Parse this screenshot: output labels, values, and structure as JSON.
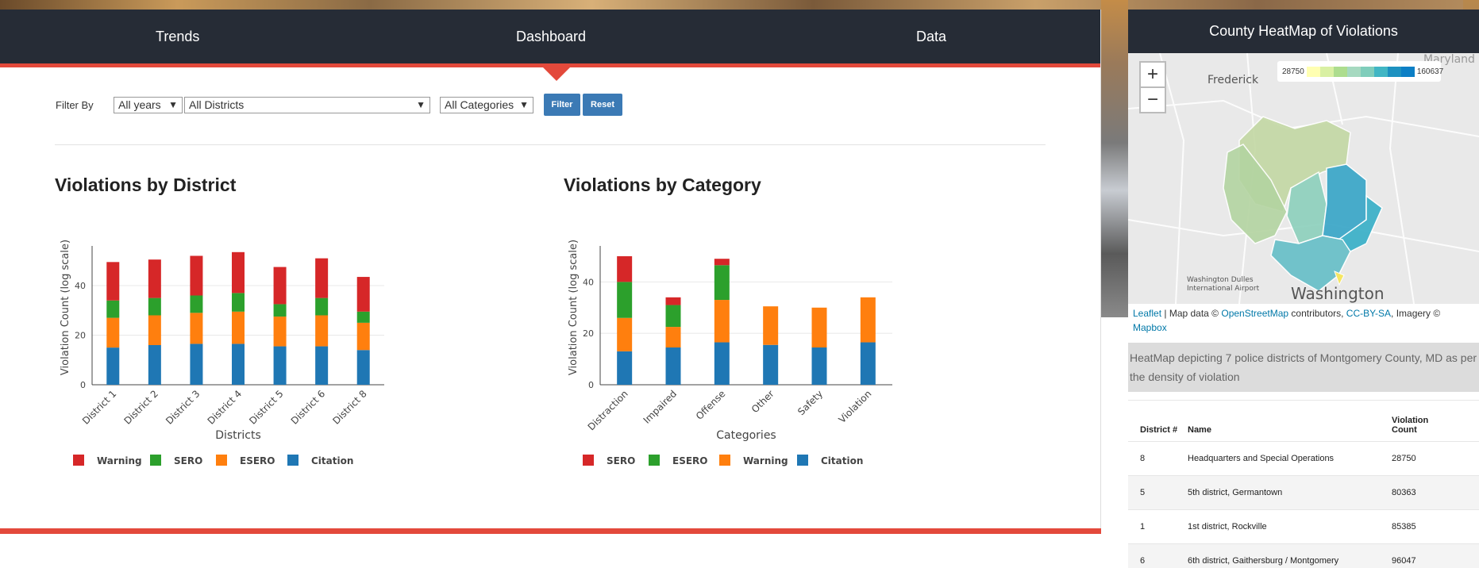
{
  "nav": {
    "items": [
      "Trends",
      "Dashboard",
      "Data"
    ]
  },
  "filters": {
    "label": "Filter By",
    "year": "All years",
    "district": "All Districts",
    "category": "All Categories",
    "filter_button": "Filter",
    "reset_button": "Reset"
  },
  "chart1": {
    "title": "Violations by District",
    "chart_data": {
      "type": "bar",
      "stacked": true,
      "xlabel": "Districts",
      "ylabel": "Violation Count (log scale)",
      "yticks": [
        0,
        20,
        40
      ],
      "ylim": [
        0,
        56
      ],
      "categories": [
        "District 1",
        "District 2",
        "District 3",
        "District 4",
        "District 5",
        "District 6",
        "District 8"
      ],
      "series": [
        {
          "name": "Citation",
          "color": "#1f77b4",
          "values": [
            15,
            16,
            16.5,
            16.5,
            15.5,
            15.5,
            14
          ]
        },
        {
          "name": "ESERO",
          "color": "#ff7f0e",
          "values": [
            12,
            12,
            12.5,
            13,
            12,
            12.5,
            11
          ]
        },
        {
          "name": "SERO",
          "color": "#2ca02c",
          "values": [
            7,
            7,
            7,
            7.5,
            5,
            7,
            4.5
          ]
        },
        {
          "name": "Warning",
          "color": "#d62728",
          "values": [
            15.5,
            15.5,
            16,
            16.5,
            15,
            16,
            14
          ]
        }
      ],
      "legend_order": [
        "Warning",
        "SERO",
        "ESERO",
        "Citation"
      ]
    }
  },
  "chart2": {
    "title": "Violations by Category",
    "chart_data": {
      "type": "bar",
      "stacked": true,
      "xlabel": "Categories",
      "ylabel": "Violation Count (log scale)",
      "yticks": [
        0,
        20,
        40
      ],
      "ylim": [
        0,
        54
      ],
      "categories": [
        "Distraction",
        "Impaired",
        "Offense",
        "Other",
        "Safety",
        "Violation"
      ],
      "series": [
        {
          "name": "Citation",
          "color": "#1f77b4",
          "values": [
            13,
            14.5,
            16.5,
            15.5,
            14.5,
            16.5
          ]
        },
        {
          "name": "Warning",
          "color": "#ff7f0e",
          "values": [
            13,
            8,
            16.5,
            15,
            15.5,
            17.5
          ]
        },
        {
          "name": "ESERO",
          "color": "#2ca02c",
          "values": [
            14,
            8.5,
            13.5,
            0,
            0,
            0
          ]
        },
        {
          "name": "SERO",
          "color": "#d62728",
          "values": [
            10,
            3,
            2.5,
            0,
            0,
            0
          ]
        }
      ],
      "legend_order": [
        "SERO",
        "ESERO",
        "Warning",
        "Citation"
      ]
    }
  },
  "right": {
    "title": "County HeatMap of Violations",
    "map": {
      "zoom_in": "+",
      "zoom_out": "−",
      "legend_min": "28750",
      "legend_max": "160637",
      "legend_colors": [
        "#ffffb2",
        "#d9f0a3",
        "#addd8e",
        "#a6d9c0",
        "#7fcdbb",
        "#41b6c4",
        "#1d91c0",
        "#0c7fc5"
      ],
      "labels": {
        "frederick": "Frederick",
        "maryland": "Maryland",
        "airport_1": "Washington Dulles",
        "airport_2": "International Airport",
        "washington": "Washington"
      }
    },
    "attribution": {
      "leaflet": "Leaflet",
      "sep1": " | Map data © ",
      "osm": "OpenStreetMap",
      "contrib": " contributors, ",
      "license": "CC-BY-SA",
      "imagery": ", Imagery © ",
      "mapbox": "Mapbox"
    },
    "caption": "HeatMap depicting 7 police districts of Montgomery County, MD as per the density of violation",
    "table": {
      "headers": [
        "District #",
        "Name",
        "Violation Count"
      ],
      "rows": [
        [
          "8",
          "Headquarters and Special Operations",
          "28750"
        ],
        [
          "5",
          "5th district, Germantown",
          "80363"
        ],
        [
          "1",
          "1st district, Rockville",
          "85385"
        ],
        [
          "6",
          "6th district, Gaithersburg / Montgomery",
          "96047"
        ]
      ]
    }
  }
}
